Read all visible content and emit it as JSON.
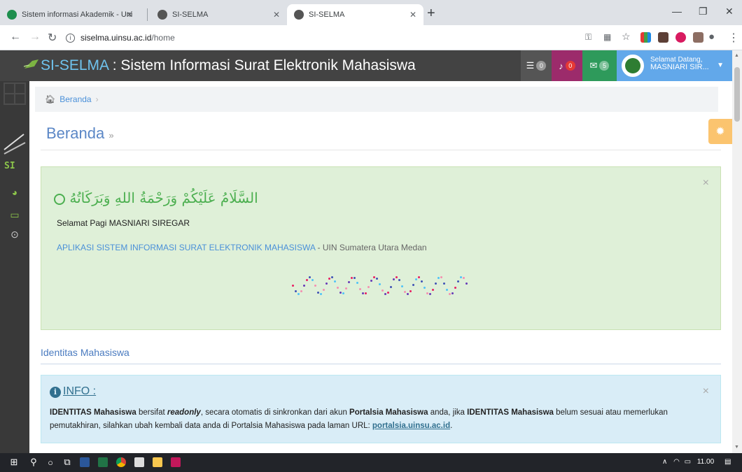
{
  "browser": {
    "tabs": [
      {
        "title": "Sistem informasi Akademik - Uni",
        "icon": "green-favicon-icon"
      },
      {
        "title": "SI-SELMA",
        "icon": "globe-icon"
      },
      {
        "title": "SI-SELMA",
        "icon": "globe-icon",
        "active": true
      }
    ],
    "new_tab": "+",
    "url_host": "siselma.uinsu.ac.id",
    "url_path": "/home"
  },
  "app": {
    "brand": "SI-SELMA",
    "separator": " : ",
    "subtitle": "Sistem Informasi Surat Elektronik Mahasiswa",
    "badges": {
      "tasks": "0",
      "notifications": "0",
      "messages": "5"
    },
    "greeting": "Selamat Datang,",
    "user_short": "MASNIARI SIR..."
  },
  "breadcrumb": {
    "home": "Beranda",
    "sep": "›"
  },
  "page_title": "Beranda",
  "page_title_arrow": "»",
  "welcome": {
    "arabic": "السَّلَامُ عَلَيْكُمْ وَرَحْمَةُ اللهِ وَبَرَكَاتُهُ",
    "greeting": "Selamat Pagi MASNIARI SIREGAR",
    "app_name": "APLIKASI SISTEM INFORMASI SURAT ELEKTRONIK MAHASISWA",
    "app_suffix": " - UIN Sumatera Utara Medan"
  },
  "section_title": "Identitas Mahasiswa",
  "info": {
    "title": "INFO :",
    "p1": "IDENTITAS Mahasiswa",
    "p2": " bersifat ",
    "p3": "readonly",
    "p4": ", secara otomatis di sinkronkan dari akun ",
    "p5": "Portalsia Mahasiswa",
    "p6": " anda, jika ",
    "p7": "IDENTITAS Mahasiswa",
    "p8": " belum sesuai atau memerlukan pemutakhiran, silahkan ubah kembali data anda di Portalsia Mahasiswa pada laman URL: ",
    "link": "portalsia.uinsu.ac.id",
    "p9": "."
  },
  "taskbar": {
    "time": "11.00"
  },
  "colors": {
    "appbar": "#434343",
    "tasks_btn": "#555555",
    "notif_btn": "#9c2b6b",
    "msg_btn": "#2e9a5b",
    "user_btn": "#62a8ea",
    "accent_blue": "#6fc3ee",
    "success_bg": "#dff0d8",
    "info_bg": "#d9edf7"
  }
}
